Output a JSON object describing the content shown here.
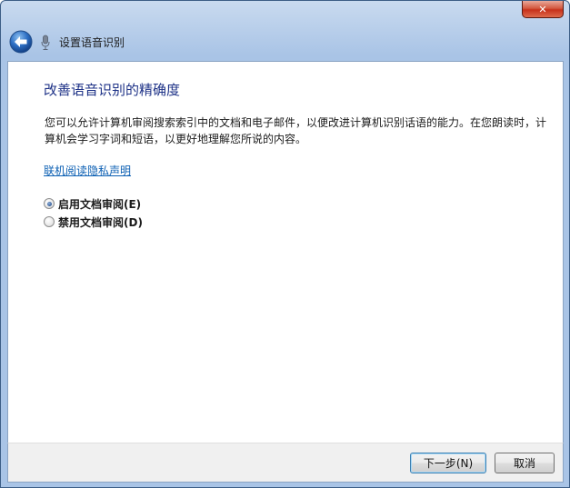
{
  "window": {
    "nav_title": "设置语音识别",
    "close_glyph": "✕"
  },
  "content": {
    "heading": "改善语音识别的精确度",
    "description": "您可以允许计算机审阅搜索索引中的文档和电子邮件，以便改进计算机识别话语的能力。在您朗读时，计算机会学习字词和短语，以更好地理解您所说的内容。",
    "privacy_link": "联机阅读隐私声明",
    "options": [
      {
        "label": "启用文档审阅(E)",
        "selected": true
      },
      {
        "label": "禁用文档审阅(D)",
        "selected": false
      }
    ]
  },
  "footer": {
    "next_label": "下一步(N)",
    "cancel_label": "取消"
  },
  "colors": {
    "heading": "#1e3287",
    "link": "#0b5fb3",
    "close_button": "#c7311b"
  }
}
